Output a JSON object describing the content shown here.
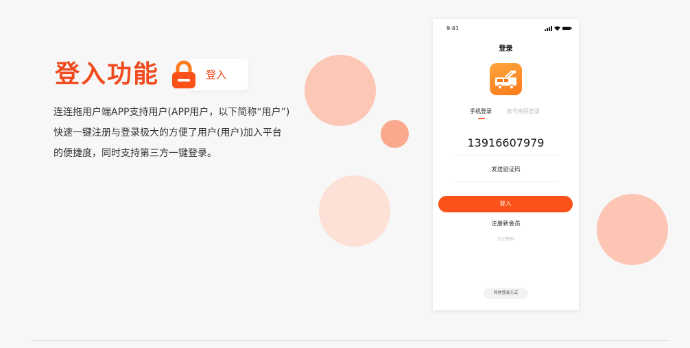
{
  "feature": {
    "title": "登入功能",
    "badge_label": "登入",
    "icon": "lock-icon",
    "accent_color": "#f04a1f",
    "description": "连连拖用户端APP支持用户(APP用户，以下简称“用户”)快速一键注册与登录极大的方便了用户(用户)加入平台的便捷度，同时支持第三方一键登录。"
  },
  "phone": {
    "status_time": "9:41",
    "status_icons": [
      "signal-icon",
      "wifi-icon",
      "battery-icon"
    ],
    "page_title": "登录",
    "app_icon": "tow-truck-app-icon",
    "tabs": [
      {
        "label": "手机登录",
        "active": true
      },
      {
        "label": "账号密码登录",
        "active": false
      }
    ],
    "phone_number": "13916607979",
    "send_code_label": "发送验证码",
    "login_button_label": "登入",
    "button_color": "#fb5219",
    "register_label": "注册新会员",
    "forgot_label": "忘记密码",
    "other_login_label": "其他登录方式"
  },
  "colors": {
    "background": "#f7f7f7",
    "circle_light": "#fde0d6",
    "circle_mid": "#fcc7b5",
    "circle_dark": "#fba98e"
  }
}
